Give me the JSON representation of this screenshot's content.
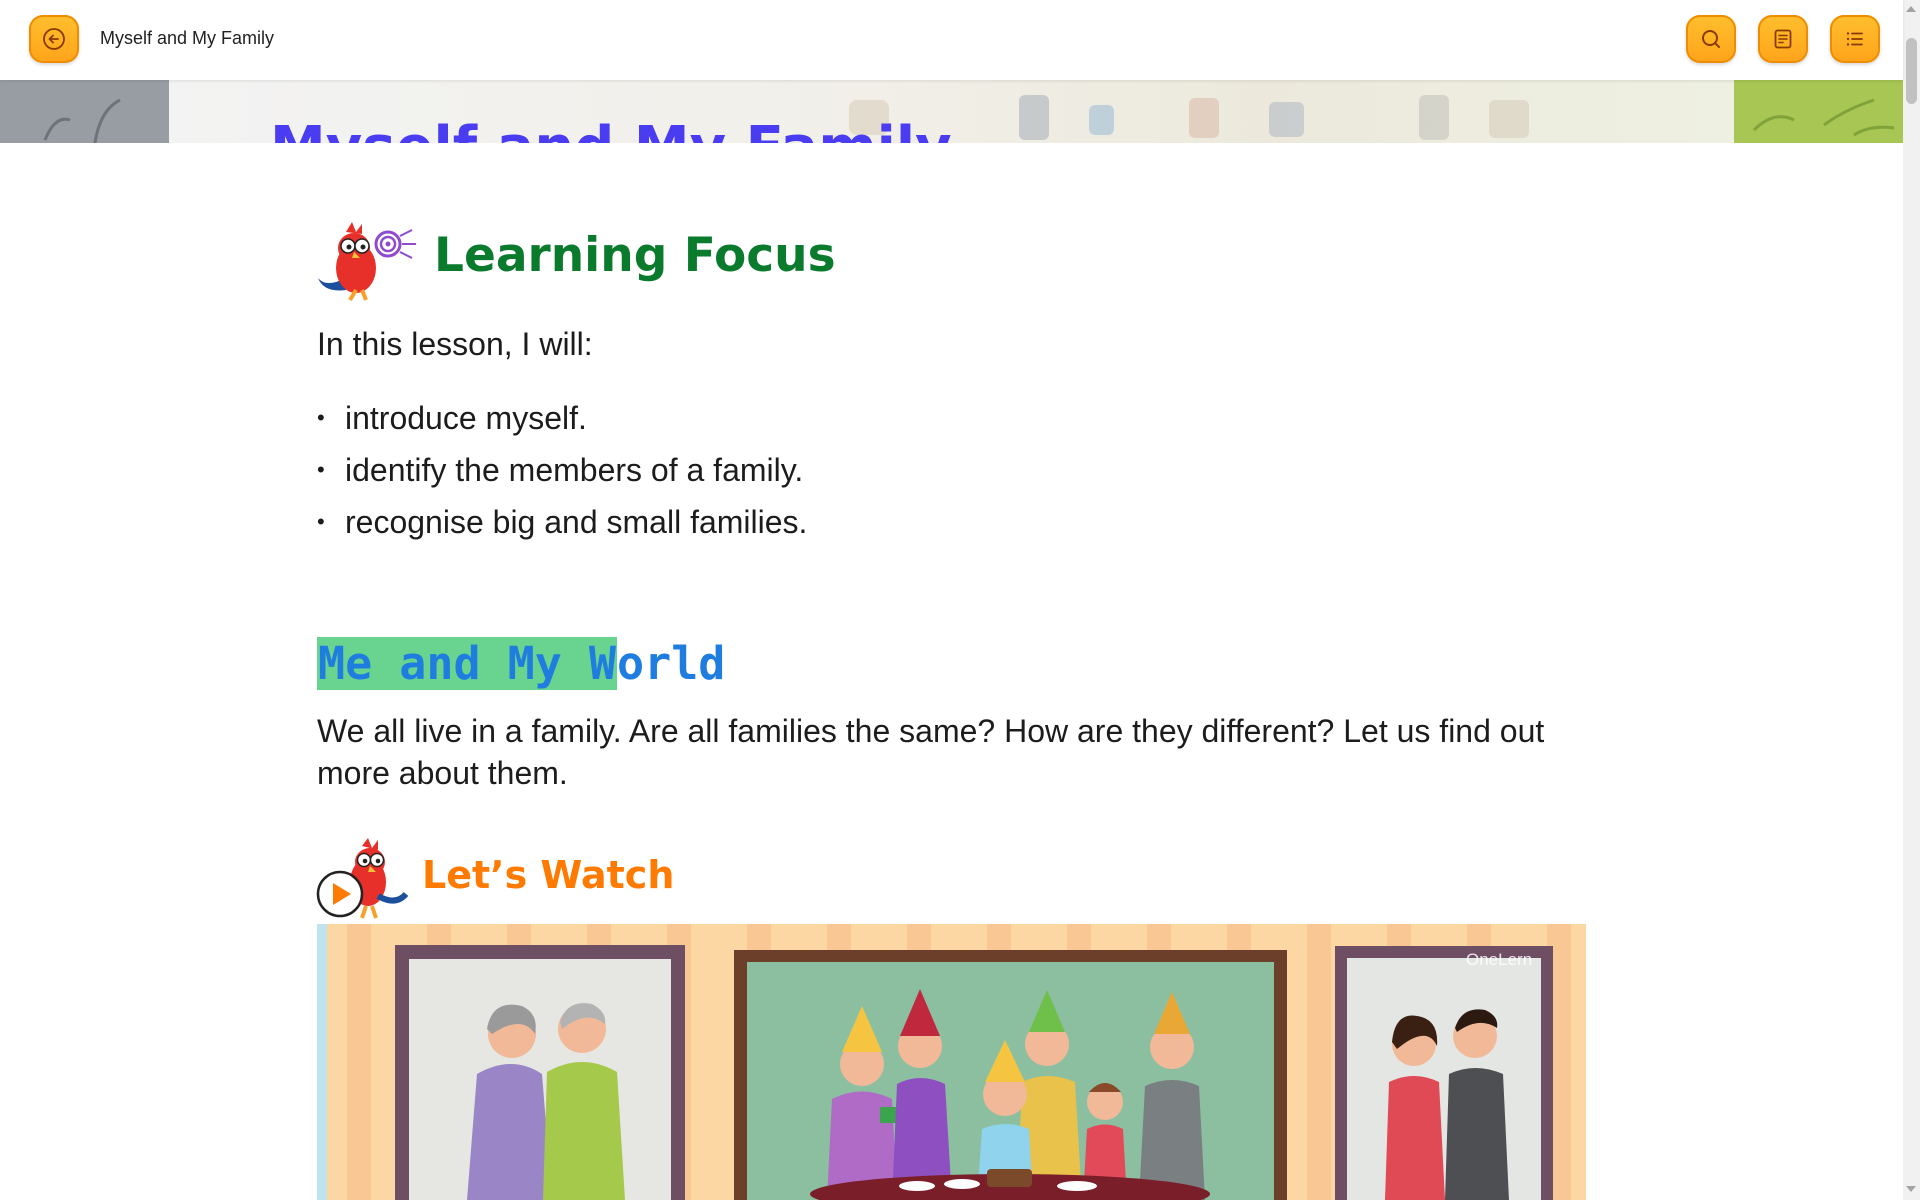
{
  "header": {
    "title": "Myself and My Family",
    "back_icon": "arrow-left-icon",
    "search_icon": "search-icon",
    "notes_icon": "notes-icon",
    "menu_icon": "list-icon",
    "accent_color": "#ffa41a"
  },
  "banner": {
    "title": "Myself and My Family",
    "title_color": "#4a3cf0"
  },
  "learning_focus": {
    "heading": "Learning Focus",
    "intro": "In this lesson, I will:",
    "bullets": [
      "introduce myself.",
      "identify the members of a family.",
      "recognise big and small families."
    ]
  },
  "world": {
    "heading_highlighted": "Me and My W",
    "heading_rest": "orld",
    "paragraph": "We all live in a family. Are all families the same? How are they different? Let us find out more about them."
  },
  "watch": {
    "heading": "Let’s Watch",
    "video_watermark": "OneLern"
  }
}
